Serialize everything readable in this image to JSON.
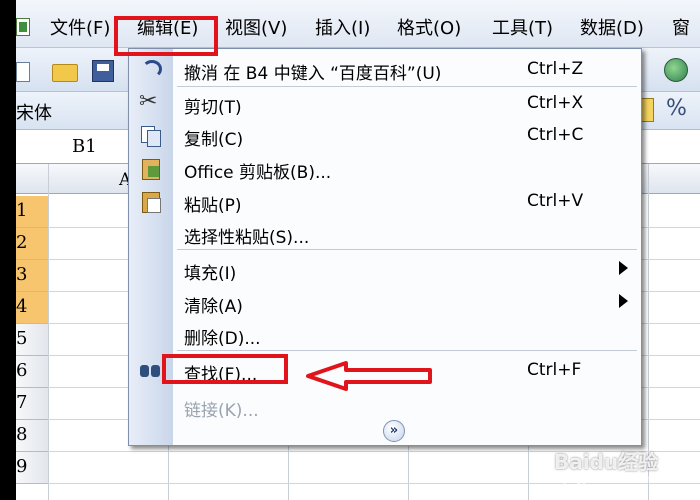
{
  "menubar": {
    "items": [
      {
        "label": "文件(F)"
      },
      {
        "label": "编辑(E)"
      },
      {
        "label": "视图(V)"
      },
      {
        "label": "插入(I)"
      },
      {
        "label": "格式(O)"
      },
      {
        "label": "工具(T)"
      },
      {
        "label": "数据(D)"
      },
      {
        "label": "窗"
      }
    ]
  },
  "toolbar": {
    "font_name": "宋体",
    "percent_symbol": "%"
  },
  "formula_bar": {
    "cell_ref": "B1"
  },
  "sheet": {
    "column_header": "A",
    "rows": [
      "1",
      "2",
      "3",
      "4",
      "5",
      "6",
      "7",
      "8",
      "9"
    ],
    "selected_rows": [
      "1",
      "2",
      "3",
      "4"
    ]
  },
  "edit_menu": {
    "items": [
      {
        "label": "撤消 在 B4 中键入 “百度百科”(U)",
        "shortcut": "Ctrl+Z"
      },
      {
        "label": "剪切(T)",
        "shortcut": "Ctrl+X"
      },
      {
        "label": "复制(C)",
        "shortcut": "Ctrl+C"
      },
      {
        "label": "Office 剪贴板(B)...",
        "shortcut": ""
      },
      {
        "label": "粘贴(P)",
        "shortcut": "Ctrl+V"
      },
      {
        "label": "选择性粘贴(S)...",
        "shortcut": ""
      },
      {
        "label": "填充(I)",
        "shortcut": ""
      },
      {
        "label": "清除(A)",
        "shortcut": ""
      },
      {
        "label": "删除(D)...",
        "shortcut": ""
      },
      {
        "label": "查找(F)...",
        "shortcut": "Ctrl+F"
      },
      {
        "label": "链接(K)...",
        "shortcut": ""
      }
    ],
    "expand_glyph": "»"
  },
  "annotation_colors": {
    "highlight": "#e1141b"
  },
  "watermark": {
    "text": "Baidu经验",
    "sub": "jingyan.baidu.com"
  }
}
